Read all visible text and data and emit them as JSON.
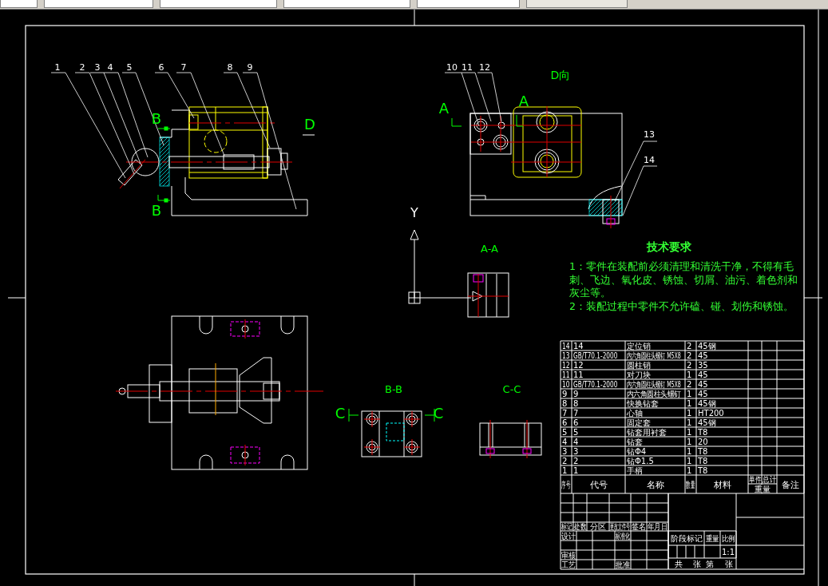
{
  "drawing": {
    "balloons": [
      "1",
      "2",
      "3",
      "4",
      "5",
      "6",
      "7",
      "8",
      "9",
      "10",
      "11",
      "12",
      "13",
      "14"
    ],
    "view_labels": [
      {
        "text": "B",
        "kind": "section"
      },
      {
        "text": "B",
        "kind": "section"
      },
      {
        "text": "D",
        "kind": "section"
      },
      {
        "text": "A",
        "kind": "section"
      },
      {
        "text": "A",
        "kind": "section"
      },
      {
        "text": "D向",
        "kind": "title"
      },
      {
        "text": "Y",
        "kind": "axis"
      },
      {
        "text": "A-A",
        "kind": "title"
      },
      {
        "text": "B-B",
        "kind": "title"
      },
      {
        "text": "C",
        "kind": "section"
      },
      {
        "text": "C",
        "kind": "section"
      },
      {
        "text": "C-C",
        "kind": "title"
      }
    ]
  },
  "technical_requirements": {
    "title": "技术要求",
    "items": [
      {
        "lines": [
          "1：零件在装配前必须清理和清洗干净，不得有毛",
          "刺、飞边、氧化皮、锈蚀、切屑、油污、着色剂和",
          "灰尘等。"
        ]
      },
      {
        "lines": [
          "2：装配过程中零件不允许磕、碰、划伤和锈蚀。"
        ]
      }
    ]
  },
  "parts_list": {
    "rows": [
      {
        "no": "14",
        "code": "14",
        "name": "定位销",
        "qty": "2",
        "material": "45钢"
      },
      {
        "no": "13",
        "code": "GB/T70.1-2000",
        "name": "内六角圆柱头螺钉 M5X8",
        "qty": "2",
        "material": "45"
      },
      {
        "no": "12",
        "code": "12",
        "name": "圆柱销",
        "qty": "2",
        "material": "35"
      },
      {
        "no": "11",
        "code": "11",
        "name": "对刀块",
        "qty": "1",
        "material": "45"
      },
      {
        "no": "10",
        "code": "GB/T70.1-2000",
        "name": "内六角圆柱头螺钉 M5X8",
        "qty": "2",
        "material": "45"
      },
      {
        "no": "9",
        "code": "9",
        "name": "内六角圆柱头螺钉",
        "qty": "1",
        "material": "45"
      },
      {
        "no": "8",
        "code": "8",
        "name": "快换钻套",
        "qty": "1",
        "material": "45钢"
      },
      {
        "no": "7",
        "code": "7",
        "name": "心轴",
        "qty": "1",
        "material": "HT200"
      },
      {
        "no": "6",
        "code": "6",
        "name": "固定套",
        "qty": "1",
        "material": "45钢"
      },
      {
        "no": "5",
        "code": "5",
        "name": "钻套用衬套",
        "qty": "1",
        "material": "T8"
      },
      {
        "no": "4",
        "code": "4",
        "name": "钻套",
        "qty": "1",
        "material": "20"
      },
      {
        "no": "3",
        "code": "3",
        "name": "钻Φ4",
        "qty": "1",
        "material": "T8"
      },
      {
        "no": "2",
        "code": "2",
        "name": "钻Φ1.5",
        "qty": "1",
        "material": "T8"
      },
      {
        "no": "1",
        "code": "1",
        "name": "手柄",
        "qty": "1",
        "material": "T8"
      }
    ],
    "header": {
      "no": "序号",
      "code": "代号",
      "name": "名称",
      "qty": "数量",
      "material": "材料",
      "unit": "单件",
      "total": "总计",
      "weight": "重量",
      "remark": "备注"
    }
  },
  "title_block": {
    "revision_headers": [
      "标记",
      "处数",
      "分区",
      "更改文件号",
      "签名",
      "年月日"
    ],
    "labels": [
      "设计",
      "标准化",
      "审核",
      "工艺",
      "批准"
    ],
    "stage_headers": [
      "阶段标记",
      "重量",
      "比例"
    ],
    "scale": "1:1",
    "sheet": [
      "共",
      "张",
      "第",
      "张"
    ]
  }
}
